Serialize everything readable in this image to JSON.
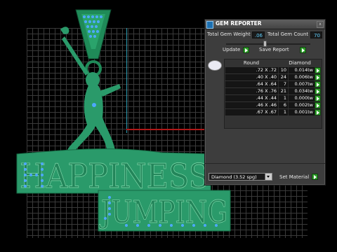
{
  "viewport": {
    "accent_green": "#2e8b63",
    "gem_blue": "#4aa3ff"
  },
  "panel": {
    "title": "GEM REPORTER",
    "title_icon": "gem-reporter-icon",
    "close_label": "x",
    "total_gem_weight_label": "Total Gem Weight",
    "total_gem_weight_value": ".06",
    "total_gem_count_label": "Total Gem Count",
    "total_gem_count_value": "70",
    "update_label": "Update",
    "save_report_label": "Save Report",
    "columns": [
      "Round",
      "Diamond"
    ],
    "rows": [
      {
        "size": ".72 X .72",
        "count": "10",
        "weight": "0.014tw"
      },
      {
        "size": ".40 X .40",
        "count": "24",
        "weight": "0.006tw"
      },
      {
        "size": ".64 X .64",
        "count": "7",
        "weight": "0.007tw"
      },
      {
        "size": ".76 X .76",
        "count": "21",
        "weight": "0.034tw"
      },
      {
        "size": ".44 X .44",
        "count": "1",
        "weight": "0.000tw"
      },
      {
        "size": ".46 X .46",
        "count": "6",
        "weight": "0.002tw"
      },
      {
        "size": ".67 X .67",
        "count": "1",
        "weight": "0.001tw"
      }
    ],
    "material_value": "Diamond   (3.52 spg)",
    "set_material_label": "Set Material"
  }
}
